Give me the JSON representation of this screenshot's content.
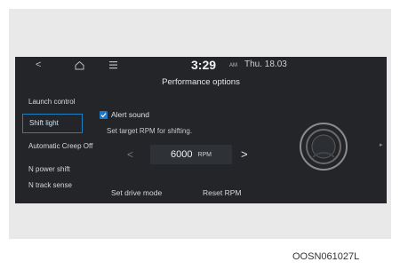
{
  "topbar": {
    "time": "3:29",
    "ampm": "AM",
    "date": "Thu. 18.03"
  },
  "title": "Performance options",
  "sidebar": {
    "items": [
      {
        "label": "Launch control"
      },
      {
        "label": "Shift light"
      },
      {
        "label": "Automatic Creep Off"
      },
      {
        "label": "N power shift"
      },
      {
        "label": "N track sense"
      }
    ]
  },
  "main": {
    "alert_sound_label": "Alert sound",
    "alert_sound_checked": true,
    "target_label": "Set target RPM for shifting.",
    "rpm_value": "6000",
    "rpm_unit": "RPM",
    "set_drive_mode": "Set drive mode",
    "reset_rpm": "Reset RPM"
  },
  "caption": "OOSN061027L",
  "colors": {
    "accent": "#1f78c4",
    "screen_bg": "#232529"
  }
}
